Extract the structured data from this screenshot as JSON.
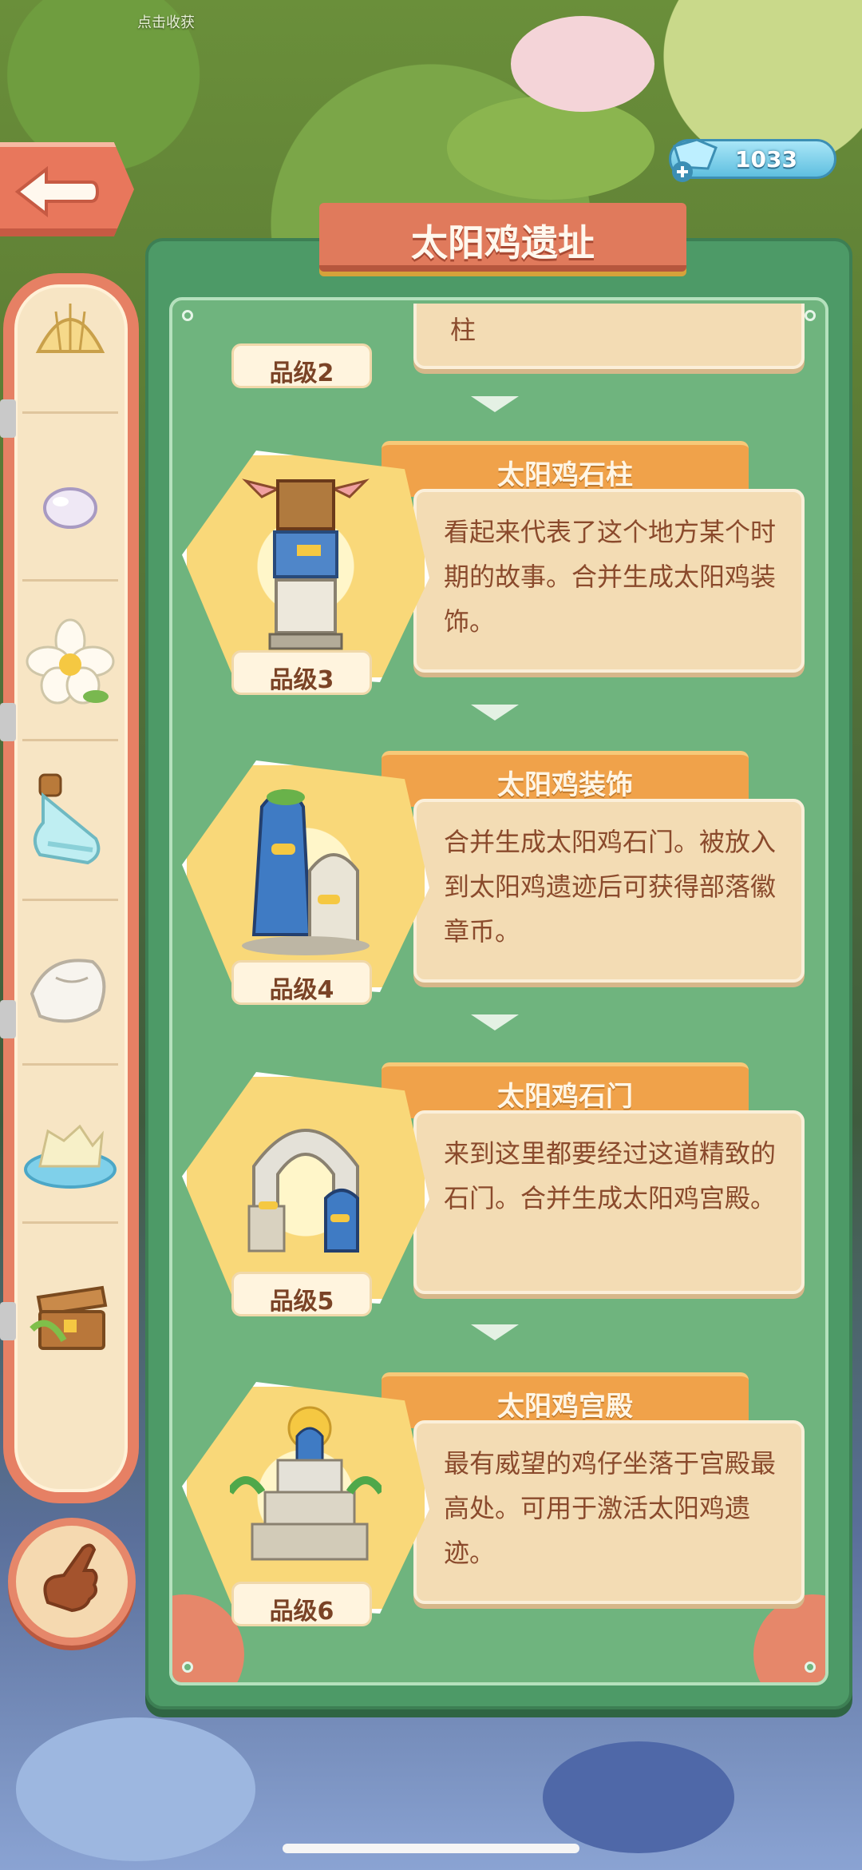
{
  "background": {
    "hint_text": "点击收获"
  },
  "header": {
    "title": "太阳鸡遗址",
    "gems": "1033"
  },
  "rail": {
    "items": [
      {
        "icon": "shell-icon"
      },
      {
        "icon": "pearl-icon"
      },
      {
        "icon": "flower-icon"
      },
      {
        "icon": "bottle-icon"
      },
      {
        "icon": "conch-icon"
      },
      {
        "icon": "water-puddle-icon"
      },
      {
        "icon": "treasure-chest-icon"
      }
    ]
  },
  "partial_item": {
    "desc_tail": "柱",
    "grade": "品级2"
  },
  "items": [
    {
      "name": "太阳鸡石柱",
      "grade": "品级3",
      "desc": "看起来代表了这个地方某个时期的故事。合并生成太阳鸡装饰。",
      "icon": "totem-pillar-icon"
    },
    {
      "name": "太阳鸡装饰",
      "grade": "品级4",
      "desc": "合并生成太阳鸡石门。被放入到太阳鸡遗迹后可获得部落徽章币。",
      "icon": "chick-statues-icon"
    },
    {
      "name": "太阳鸡石门",
      "grade": "品级5",
      "desc": "来到这里都要经过这道精致的石门。合并生成太阳鸡宫殿。",
      "icon": "stone-gate-icon"
    },
    {
      "name": "太阳鸡宫殿",
      "grade": "品级6",
      "desc": "最有威望的鸡仔坐落于宫殿最高处。可用于激活太阳鸡遗迹。",
      "icon": "temple-palace-icon"
    }
  ],
  "colors": {
    "panel": "#4d9a67",
    "accent": "#e07a5c",
    "card": "#f3dcb4"
  }
}
